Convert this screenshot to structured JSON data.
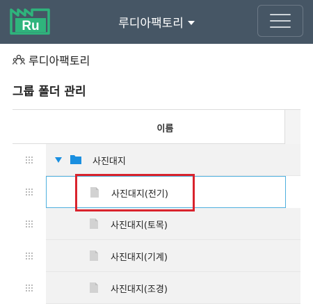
{
  "header": {
    "logo_text": "Ru",
    "project_name": "루디아팩토리",
    "menu_button": "menu",
    "colors": {
      "navbar": "#465665",
      "logo": "#2fb47c",
      "accent": "#1a8fe0",
      "highlight": "#d9232d"
    }
  },
  "breadcrumb": {
    "project": "루디아팩토리",
    "icon": "users-icon"
  },
  "page": {
    "title": "그룹 폴더 관리"
  },
  "table": {
    "header": "이름",
    "rows": [
      {
        "label": "사진대지",
        "type": "folder",
        "expanded": true
      },
      {
        "label": "사진대지(전기)",
        "type": "file",
        "selected": true
      },
      {
        "label": "사진대지(토목)",
        "type": "file"
      },
      {
        "label": "사진대지(기계)",
        "type": "file"
      },
      {
        "label": "사진대지(조경)",
        "type": "file"
      }
    ]
  }
}
